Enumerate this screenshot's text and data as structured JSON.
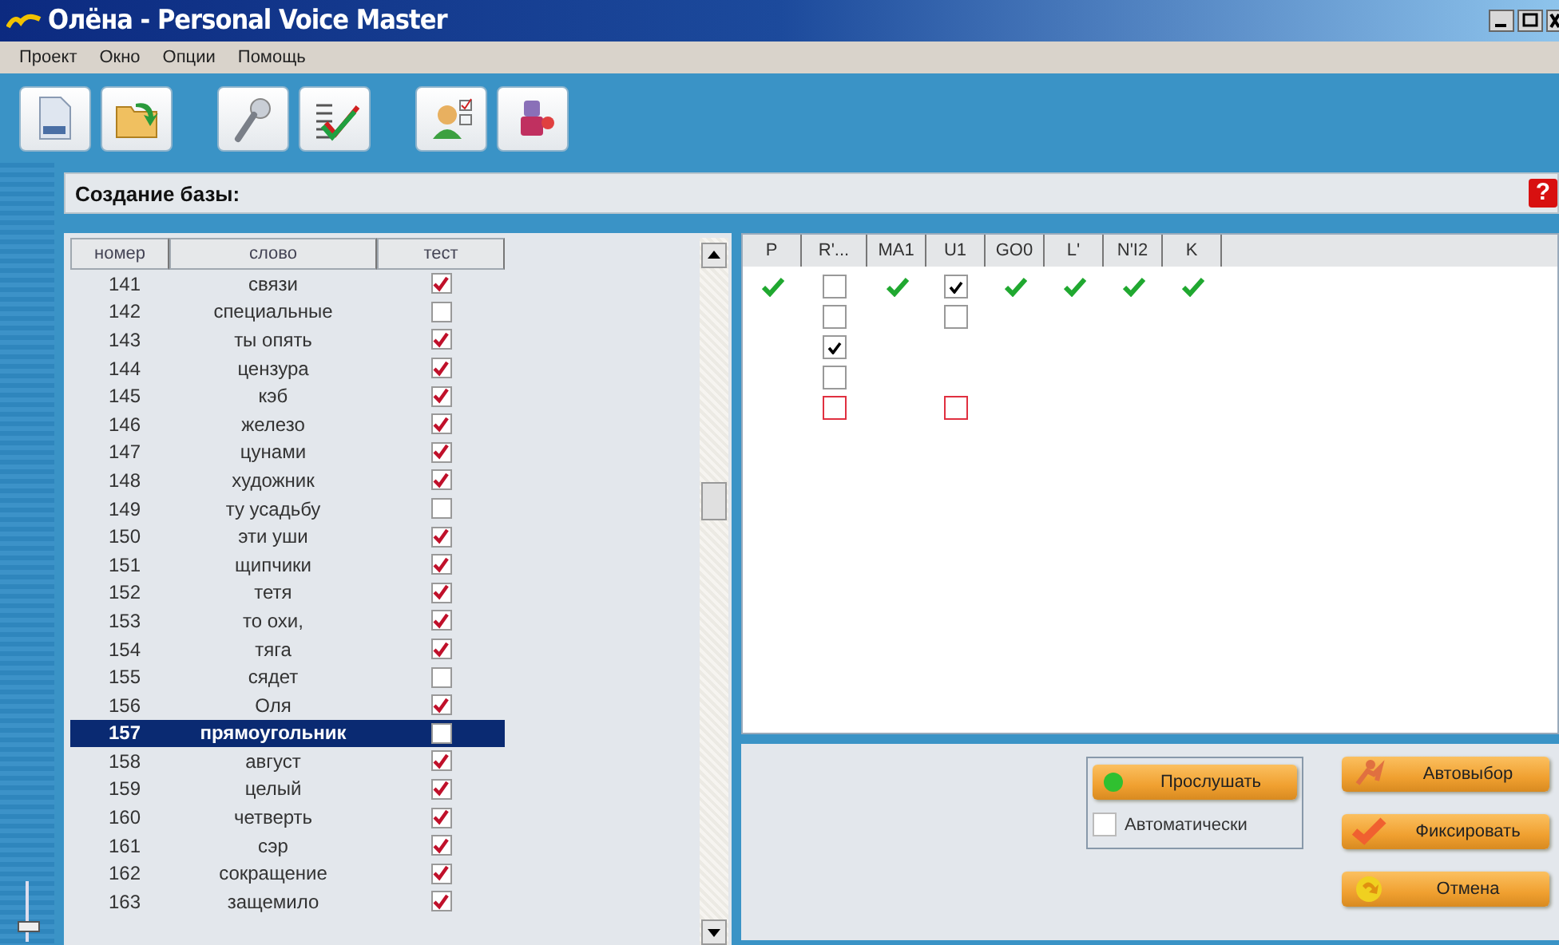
{
  "window": {
    "title": "Олёна - Personal Voice Master"
  },
  "menu": [
    "Проект",
    "Окно",
    "Опции",
    "Помощь"
  ],
  "toolbar": [
    {
      "kind": "document"
    },
    {
      "kind": "open"
    },
    {
      "kind": "microphone"
    },
    {
      "kind": "checklist"
    },
    {
      "kind": "person"
    },
    {
      "kind": "tools"
    }
  ],
  "panel": {
    "title": "Создание базы:",
    "help": "?"
  },
  "side_slider": {
    "level": 0.15
  },
  "word_table": {
    "columns": [
      "номер",
      "слово",
      "тест"
    ],
    "rows": [
      {
        "number": "141",
        "word": "связи",
        "test": true,
        "selected": false
      },
      {
        "number": "142",
        "word": "специальные",
        "test": false,
        "selected": false
      },
      {
        "number": "143",
        "word": "ты опять",
        "test": true,
        "selected": false
      },
      {
        "number": "144",
        "word": "цензура",
        "test": true,
        "selected": false
      },
      {
        "number": "145",
        "word": "кэб",
        "test": true,
        "selected": false
      },
      {
        "number": "146",
        "word": "железо",
        "test": true,
        "selected": false
      },
      {
        "number": "147",
        "word": "цунами",
        "test": true,
        "selected": false
      },
      {
        "number": "148",
        "word": "художник",
        "test": true,
        "selected": false
      },
      {
        "number": "149",
        "word": "ту усадьбу",
        "test": false,
        "selected": false
      },
      {
        "number": "150",
        "word": "эти уши",
        "test": true,
        "selected": false
      },
      {
        "number": "151",
        "word": "щипчики",
        "test": true,
        "selected": false
      },
      {
        "number": "152",
        "word": "тетя",
        "test": true,
        "selected": false
      },
      {
        "number": "153",
        "word": "то охи,",
        "test": true,
        "selected": false
      },
      {
        "number": "154",
        "word": "тяга",
        "test": true,
        "selected": false
      },
      {
        "number": "155",
        "word": "сядет",
        "test": false,
        "selected": false
      },
      {
        "number": "156",
        "word": "Оля",
        "test": true,
        "selected": false
      },
      {
        "number": "157",
        "word": "прямоугольник",
        "test": false,
        "selected": true
      },
      {
        "number": "158",
        "word": "август",
        "test": true,
        "selected": false
      },
      {
        "number": "159",
        "word": "целый",
        "test": true,
        "selected": false
      },
      {
        "number": "160",
        "word": "четверть",
        "test": true,
        "selected": false
      },
      {
        "number": "161",
        "word": "сэр",
        "test": true,
        "selected": false
      },
      {
        "number": "162",
        "word": "сокращение",
        "test": true,
        "selected": false
      },
      {
        "number": "163",
        "word": "защемило",
        "test": true,
        "selected": false
      }
    ]
  },
  "phoneme_grid": {
    "columns": [
      {
        "label": "P",
        "cells": [
          {
            "kind": "tick"
          }
        ]
      },
      {
        "label": "R'...",
        "cells": [
          {
            "kind": "checkbox",
            "checked": false,
            "color": "#999999"
          },
          {
            "kind": "checkbox",
            "checked": false,
            "color": "#999999"
          },
          {
            "kind": "checkbox",
            "checked": true,
            "color": "#999999"
          },
          {
            "kind": "checkbox",
            "checked": false,
            "color": "#999999"
          },
          {
            "kind": "checkbox",
            "checked": false,
            "color": "#e03040"
          }
        ]
      },
      {
        "label": "MA1",
        "cells": [
          {
            "kind": "tick"
          }
        ]
      },
      {
        "label": "U1",
        "cells": [
          {
            "kind": "checkbox",
            "checked": true,
            "color": "#999999"
          },
          {
            "kind": "checkbox",
            "checked": false,
            "color": "#999999"
          },
          {
            "kind": "empty"
          },
          {
            "kind": "empty"
          },
          {
            "kind": "checkbox",
            "checked": false,
            "color": "#e03040"
          }
        ]
      },
      {
        "label": "GO0",
        "cells": [
          {
            "kind": "tick"
          }
        ]
      },
      {
        "label": "L'",
        "cells": [
          {
            "kind": "tick"
          }
        ]
      },
      {
        "label": "N'I2",
        "cells": [
          {
            "kind": "tick"
          }
        ]
      },
      {
        "label": "K",
        "cells": [
          {
            "kind": "tick"
          }
        ]
      }
    ]
  },
  "listen_group": {
    "button": "Прослушать",
    "auto": {
      "label": "Автоматически",
      "checked": false
    }
  },
  "actions": [
    {
      "kind": "autoselect",
      "label": "Автовыбор"
    },
    {
      "kind": "fix",
      "label": "Фиксировать"
    },
    {
      "kind": "cancel",
      "label": "Отмена"
    }
  ]
}
